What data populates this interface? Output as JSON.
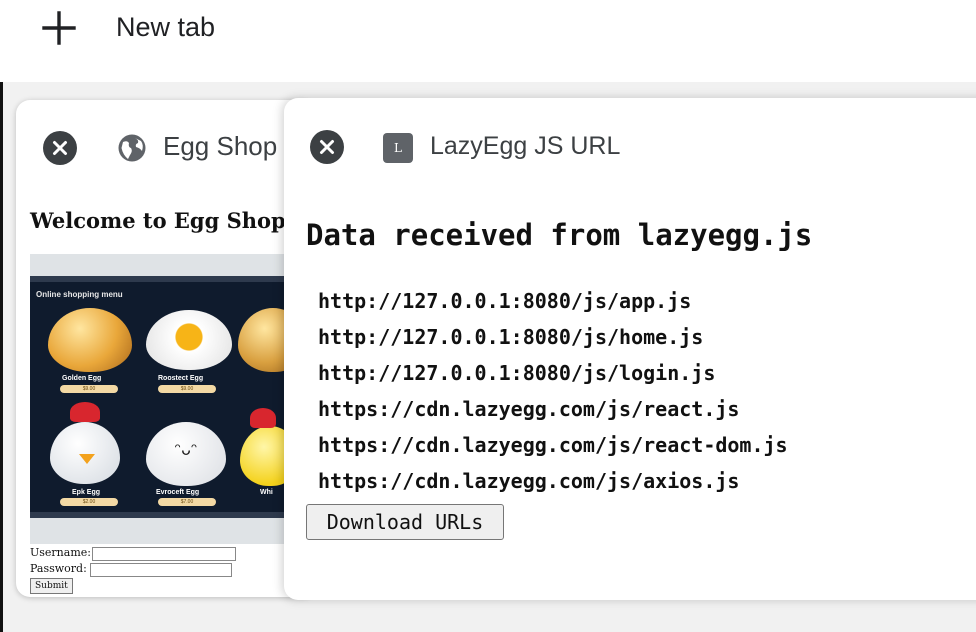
{
  "toolbar": {
    "new_tab_label": "New tab"
  },
  "tabs": {
    "egg_shop": {
      "title": "Egg Shop",
      "page": {
        "heading": "Welcome to Egg Shop",
        "menu_label": "Online shopping menu",
        "products": [
          {
            "name": "Golden Egg",
            "price": "$9.00"
          },
          {
            "name": "Roostect Egg",
            "price": "$9.00"
          },
          {
            "name": "Epk Egg",
            "price": "$2.00"
          },
          {
            "name": "Evroceft Egg",
            "price": "$7.00"
          },
          {
            "name": "Whi"
          }
        ],
        "username_label": "Username:",
        "password_label": "Password:",
        "submit_label": "Submit"
      }
    },
    "lazyegg": {
      "title": "LazyEgg JS URL",
      "icon_letter": "L",
      "heading": "Data received from lazyegg.js",
      "urls": [
        "http://127.0.0.1:8080/js/app.js",
        "http://127.0.0.1:8080/js/home.js",
        "http://127.0.0.1:8080/js/login.js",
        "https://cdn.lazyegg.com/js/react.js",
        "https://cdn.lazyegg.com/js/react-dom.js",
        "https://cdn.lazyegg.com/js/axios.js"
      ],
      "download_label": "Download URLs"
    }
  },
  "colors": {
    "background": "#f1f1f1",
    "card": "#ffffff",
    "close_icon": "#3c4043",
    "text": "#202124"
  }
}
